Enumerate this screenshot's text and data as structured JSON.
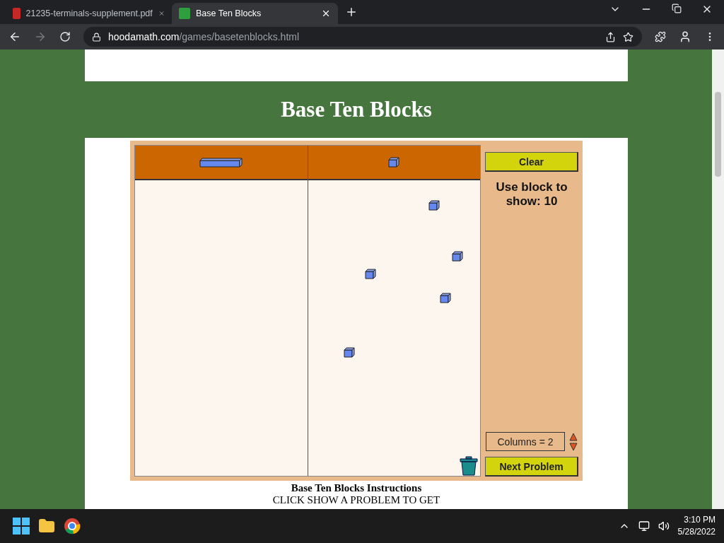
{
  "browser": {
    "tabs": [
      {
        "title": "21235-terminals-supplement.pdf",
        "selected": false,
        "kind": "pdf"
      },
      {
        "title": "Base Ten Blocks",
        "selected": true,
        "kind": "site"
      }
    ],
    "url_host": "hoodamath.com",
    "url_path": "/games/basetenblocks.html"
  },
  "page": {
    "title": "Base Ten Blocks",
    "game": {
      "columns": [
        {
          "kind": "rod"
        },
        {
          "kind": "unit",
          "placed_blocks": [
            {
              "kind": "unit"
            },
            {
              "kind": "unit"
            },
            {
              "kind": "unit"
            },
            {
              "kind": "unit"
            },
            {
              "kind": "unit"
            }
          ]
        }
      ],
      "clear_button": "Clear",
      "prompt": "Use block to show: 10",
      "columns_label": "Columns = 2",
      "next_button": "Next Problem"
    },
    "instructions_title": "Base Ten Blocks Instructions",
    "instructions_text": "CLICK SHOW A PROBLEM TO GET"
  },
  "taskbar": {
    "time": "3:10 PM",
    "date": "5/28/2022"
  }
}
